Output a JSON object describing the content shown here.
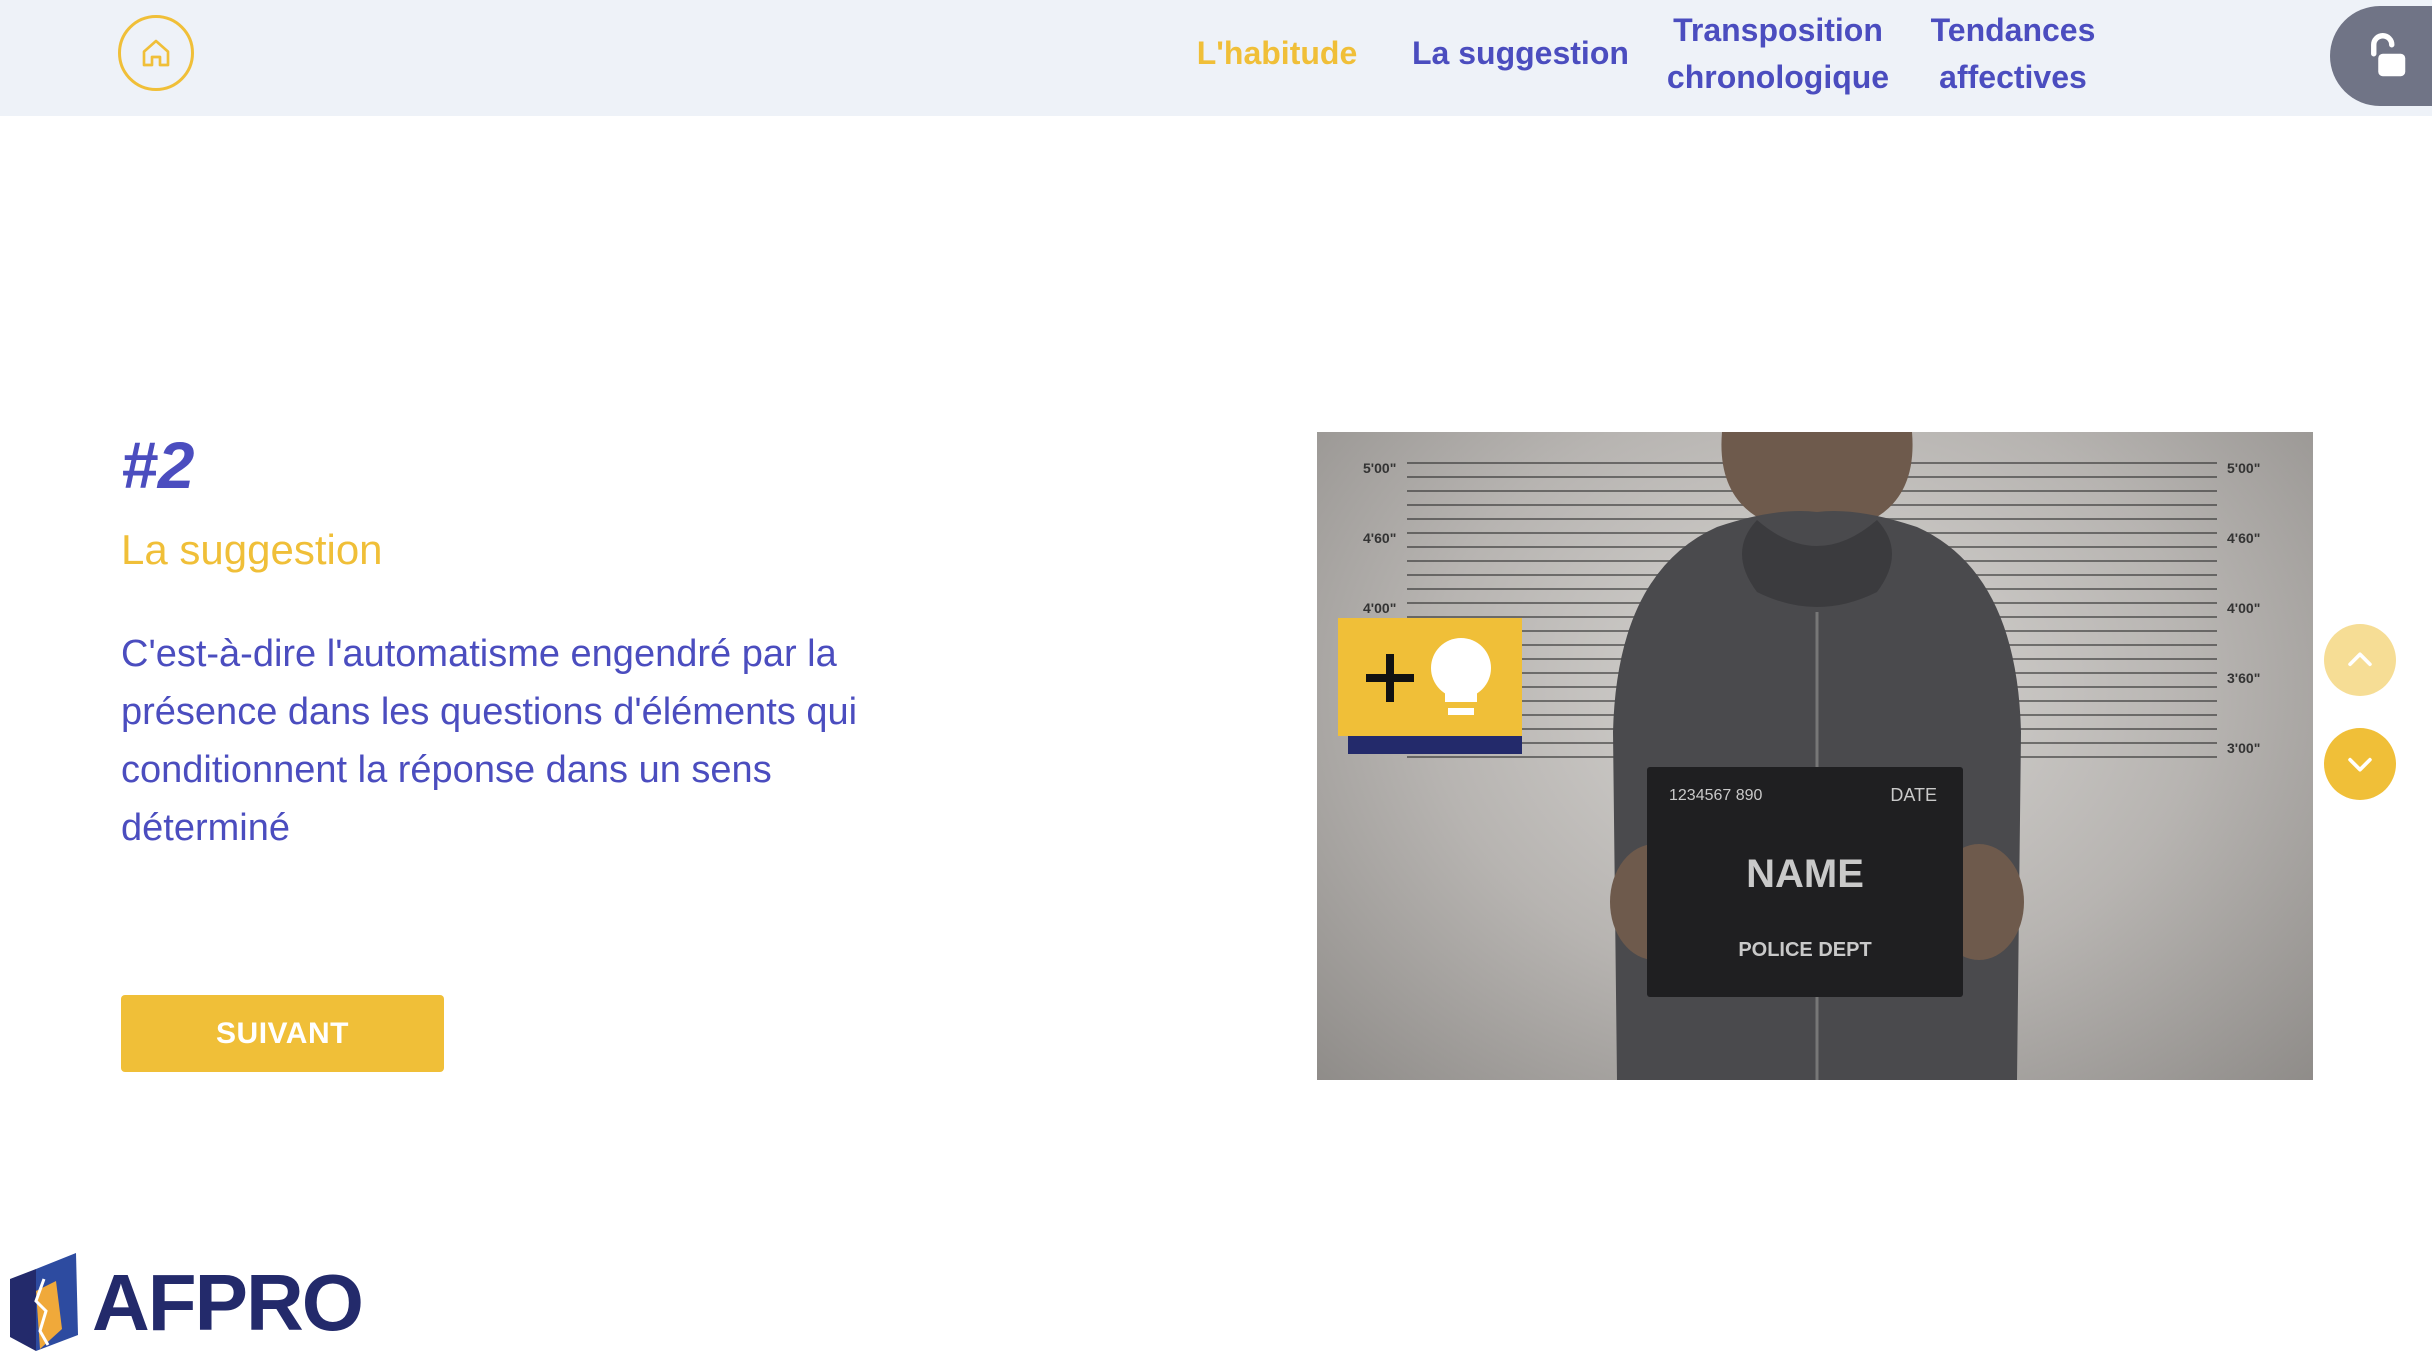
{
  "header": {
    "nav": [
      {
        "label": "L'habitude",
        "active": true
      },
      {
        "label": "La suggestion",
        "active": false
      },
      {
        "label": "Transposition chronologique",
        "active": false
      },
      {
        "label": "Tendances affectives",
        "active": false
      }
    ],
    "home_icon": "home-icon",
    "lock_icon": "unlock-icon"
  },
  "main": {
    "step_number": "#2",
    "title": "La suggestion",
    "description": "C'est-à-dire l'automatisme engendré par la présence dans les questions d'éléments qui conditionnent la réponse dans un sens déterminé",
    "next_label": "SUIVANT"
  },
  "photo": {
    "height_marks": [
      "5'00\"",
      "4'60\"",
      "4'00\"",
      "3'60\"",
      "3'00\""
    ],
    "sign_number": "1234567 890",
    "sign_date": "DATE",
    "sign_name": "NAME",
    "sign_dept": "POLICE DEPT"
  },
  "hint": {
    "icon": "lightbulb-plus-icon"
  },
  "side_nav": {
    "up_icon": "chevron-up-icon",
    "down_icon": "chevron-down-icon"
  },
  "logo": {
    "text": "AFPRO"
  },
  "colors": {
    "primary": "#4b4dbf",
    "accent": "#f0bf38",
    "header_bg": "#eef2f8",
    "navy": "#232a6b"
  }
}
